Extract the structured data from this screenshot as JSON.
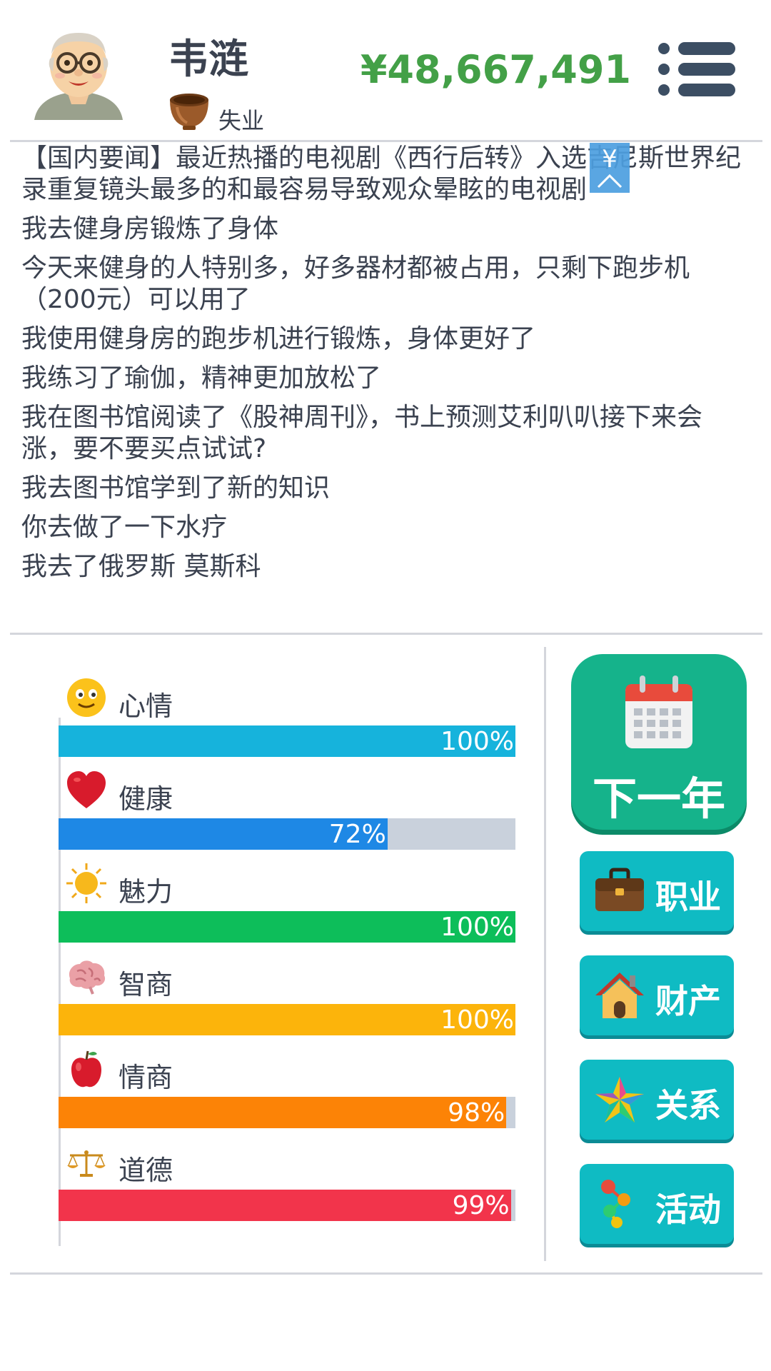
{
  "header": {
    "name": "韦涟",
    "job": "失业",
    "money": "¥48,667,491"
  },
  "log": {
    "scroll_button_symbol": "¥",
    "items": [
      "【国内要闻】最近热播的电视剧《西行后转》入选吉尼斯世界纪录重复镜头最多的和最容易导致观众晕眩的电视剧",
      "我去健身房锻炼了身体",
      "今天来健身的人特别多，好多器材都被占用，只剩下跑步机（200元）可以用了",
      "我使用健身房的跑步机进行锻炼，身体更好了",
      "我练习了瑜伽，精神更加放松了",
      "我在图书馆阅读了《股神周刊》，书上预测艾利叭叭接下来会涨，要不要买点试试?",
      "我去图书馆学到了新的知识",
      "你去做了一下水疗",
      "我去了俄罗斯 莫斯科"
    ]
  },
  "stats": [
    {
      "label": "心情",
      "value": 100,
      "display": "100%",
      "color": "#16b3dc",
      "icon": "smiley-icon"
    },
    {
      "label": "健康",
      "value": 72,
      "display": "72%",
      "color": "#1e88e5",
      "icon": "heart-icon"
    },
    {
      "label": "魅力",
      "value": 100,
      "display": "100%",
      "color": "#0dbe5a",
      "icon": "sun-icon"
    },
    {
      "label": "智商",
      "value": 100,
      "display": "100%",
      "color": "#fcb40b",
      "icon": "brain-icon"
    },
    {
      "label": "情商",
      "value": 98,
      "display": "98%",
      "color": "#fc8306",
      "icon": "apple-icon"
    },
    {
      "label": "道德",
      "value": 99,
      "display": "99%",
      "color": "#f2344b",
      "icon": "scales-icon"
    }
  ],
  "actions": {
    "next_year": "下一年",
    "career": "职业",
    "property": "财产",
    "relations": "关系",
    "activities": "活动"
  },
  "colors": {
    "money": "#43a047",
    "text": "#3b4250",
    "next_button": "#15b38b",
    "side_button": "#0fbbc3"
  }
}
